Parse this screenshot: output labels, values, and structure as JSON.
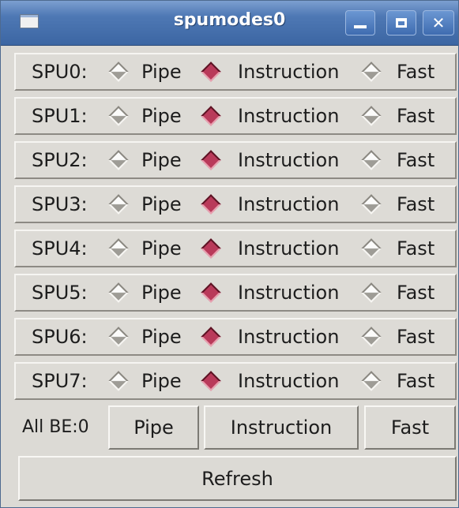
{
  "window": {
    "title": "spumodes0"
  },
  "titlebar": {
    "minimize": "minimize",
    "maximize": "maximize",
    "close": "close"
  },
  "rows": [
    {
      "label": "SPU0:",
      "pipe": "Pipe",
      "instruction": "Instruction",
      "fast": "Fast",
      "selected": "Instruction"
    },
    {
      "label": "SPU1:",
      "pipe": "Pipe",
      "instruction": "Instruction",
      "fast": "Fast",
      "selected": "Instruction"
    },
    {
      "label": "SPU2:",
      "pipe": "Pipe",
      "instruction": "Instruction",
      "fast": "Fast",
      "selected": "Instruction"
    },
    {
      "label": "SPU3:",
      "pipe": "Pipe",
      "instruction": "Instruction",
      "fast": "Fast",
      "selected": "Instruction"
    },
    {
      "label": "SPU4:",
      "pipe": "Pipe",
      "instruction": "Instruction",
      "fast": "Fast",
      "selected": "Instruction"
    },
    {
      "label": "SPU5:",
      "pipe": "Pipe",
      "instruction": "Instruction",
      "fast": "Fast",
      "selected": "Instruction"
    },
    {
      "label": "SPU6:",
      "pipe": "Pipe",
      "instruction": "Instruction",
      "fast": "Fast",
      "selected": "Instruction"
    },
    {
      "label": "SPU7:",
      "pipe": "Pipe",
      "instruction": "Instruction",
      "fast": "Fast",
      "selected": "Instruction"
    }
  ],
  "bottom": {
    "label": "All BE:0",
    "pipe_button": "Pipe",
    "instruction_button": "Instruction",
    "fast_button": "Fast",
    "refresh_button": "Refresh"
  },
  "colors": {
    "titlebar": "#4e78b4",
    "window_bg": "#dcdad5",
    "radio_selected": "#b93a5a"
  }
}
